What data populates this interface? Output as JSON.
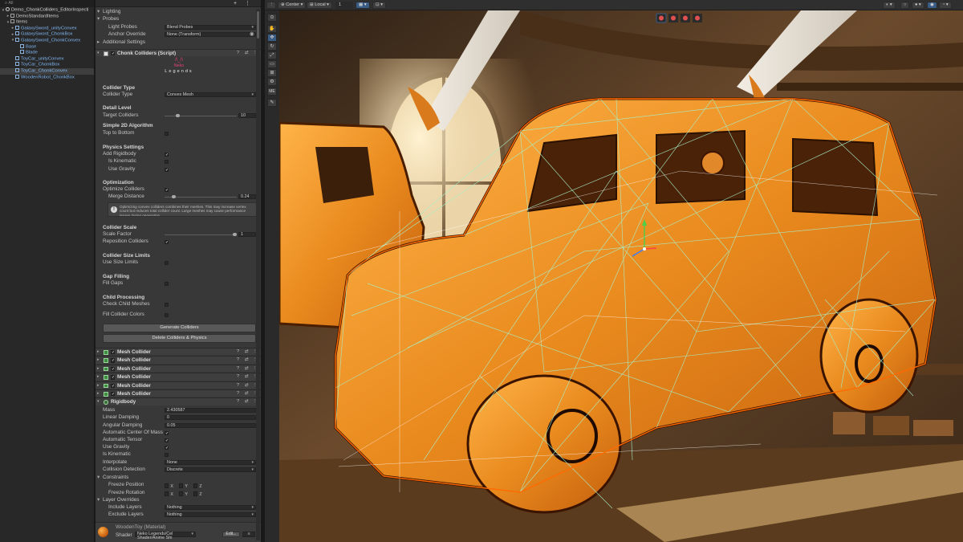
{
  "hierarchy": {
    "search": "All",
    "scene_name": "Demo_ChonkColliders_EditorInspecti",
    "items": [
      {
        "label": "DemoStandardItems"
      },
      {
        "label": "Items"
      },
      {
        "label": "GalaxySword_unityConvex"
      },
      {
        "label": "GalaxySword_ChonkBox"
      },
      {
        "label": "GalaxySword_ChonkConvex"
      },
      {
        "label": "Base"
      },
      {
        "label": "Blade"
      },
      {
        "label": "ToyCar_unityConvex"
      },
      {
        "label": "ToyCar_ChonkBox"
      },
      {
        "label": "ToyCar_ChonkConvex"
      },
      {
        "label": "WoodenRobot_ChonkBox"
      }
    ]
  },
  "inspector": {
    "lighting": "Lighting",
    "probes": "Probes",
    "light_probes_label": "Light Probes",
    "light_probes_value": "Blend Probes",
    "anchor_override_label": "Anchor Override",
    "anchor_override_value": "None (Transform)",
    "additional_settings": "Additional Settings",
    "chonk_component": "Chonk Colliders (Script)",
    "logo_neko": "Neko",
    "logo_legends": "Legends",
    "collider_type_header": "Collider Type",
    "collider_type_label": "Collider Type",
    "collider_type_value": "Convex Mesh",
    "detail_level_header": "Detail Level",
    "target_colliders_label": "Target Colliders",
    "target_colliders_value": "10",
    "simple2d_header": "Simple 2D Algorithm",
    "top_to_bottom_label": "Top to Bottom",
    "physics_settings_header": "Physics Settings",
    "add_rigidbody_label": "Add Rigidbody",
    "is_kinematic_label": "Is Kinematic",
    "use_gravity_label": "Use Gravity",
    "optimization_header": "Optimization",
    "optimize_colliders_label": "Optimize Colliders",
    "merge_distance_label": "Merge Distance",
    "merge_distance_value": "0.24",
    "help_text": "Optimizing convex colliders combines their meshes. This may increase vertex count but reduces total collider count. Large meshes may cause performance issues during generation.",
    "collider_scale_header": "Collider Scale",
    "scale_factor_label": "Scale Factor",
    "scale_factor_value": "1",
    "reposition_colliders_label": "Reposition Colliders",
    "collider_size_limits_header": "Collider Size Limits",
    "use_size_limits_label": "Use Size Limits",
    "gap_filling_header": "Gap Filling",
    "fill_gaps_label": "Fill Gaps",
    "child_processing_header": "Child Processing",
    "check_child_meshes_label": "Check Child Meshes",
    "fill_collider_colors_label": "Fill Collider Colors",
    "generate_button": "Generate Colliders",
    "delete_button": "Delete Colliders & Physics",
    "mesh_collider": "Mesh Collider",
    "rigidbody": "Rigidbody",
    "mass_label": "Mass",
    "mass_value": "2.430587",
    "linear_damping_label": "Linear Damping",
    "linear_damping_value": "0",
    "angular_damping_label": "Angular Damping",
    "angular_damping_value": "0.05",
    "auto_center_label": "Automatic Center Of Mass",
    "auto_tensor_label": "Automatic Tensor",
    "rb_use_gravity_label": "Use Gravity",
    "rb_is_kinematic_label": "Is Kinematic",
    "interpolate_label": "Interpolate",
    "interpolate_value": "None",
    "collision_detection_label": "Collision Detection",
    "collision_detection_value": "Discrete",
    "constraints_label": "Constraints",
    "freeze_position_label": "Freeze Position",
    "freeze_rotation_label": "Freeze Rotation",
    "axis_x": "X",
    "axis_y": "Y",
    "axis_z": "Z",
    "layer_overrides_label": "Layer Overrides",
    "include_layers_label": "Include Layers",
    "include_layers_value": "Nothing",
    "exclude_layers_label": "Exclude Layers",
    "exclude_layers_value": "Nothing",
    "material_name": "WoodenToy (Material)",
    "shader_label": "Shader",
    "shader_value": "Neko Legends/Cel Shader/Anime Shi",
    "shader_edit": "Edit...",
    "shader_extra": "≡"
  },
  "scene_toolbar": {
    "pivot": "Center",
    "space": "Local",
    "snap_value": "1"
  },
  "scene_tools": {
    "me_label": "ME"
  },
  "colors": {
    "accent_blue": "#3a5b84",
    "prefab_blue": "#7fb6f2",
    "wood_orange": "#e98a1e",
    "collider_wire": "#a8f0c8"
  }
}
